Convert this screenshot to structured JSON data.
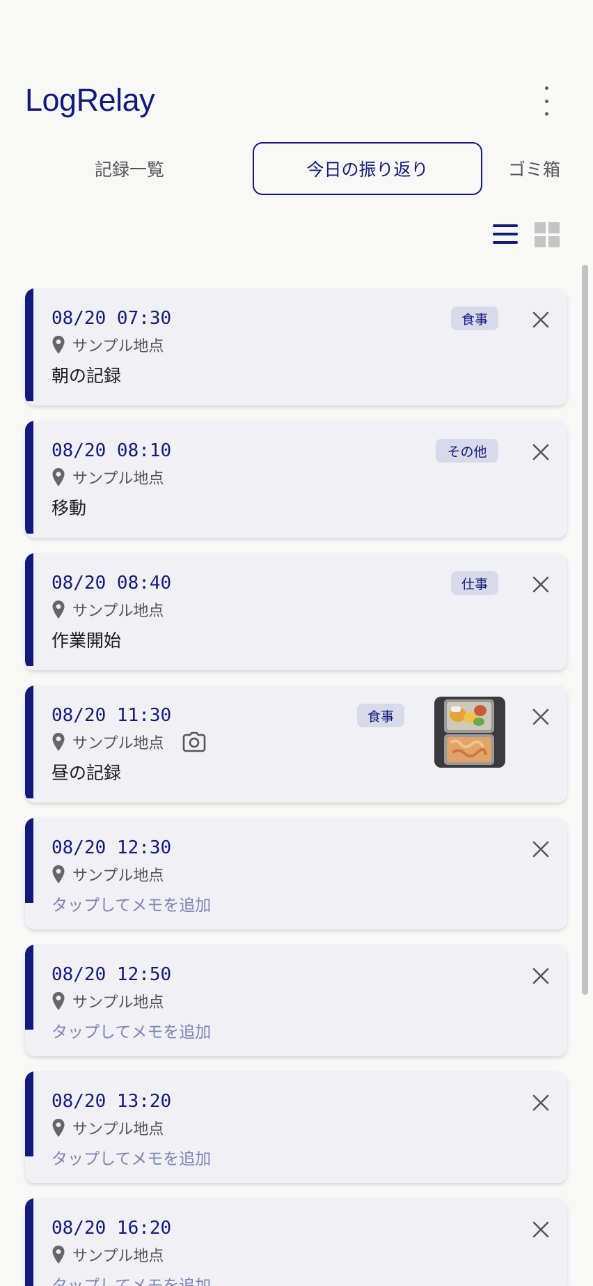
{
  "app": {
    "title": "LogRelay",
    "menu_icon": "more-vert-icon"
  },
  "tabs": [
    {
      "label": "記録一覧",
      "active": false
    },
    {
      "label": "今日の振り返り",
      "active": true
    },
    {
      "label": "ゴミ箱",
      "active": false
    }
  ],
  "view_toggle": {
    "list_icon": "list-view-icon",
    "grid_icon": "grid-view-icon",
    "selected": "list"
  },
  "colors": {
    "accent": "#121a7a",
    "card": "#f1f1f5",
    "badge_bg": "#d8d9ea",
    "placeholder": "#7d83b6"
  },
  "entries": [
    {
      "time": "08/20 07:30",
      "location": "サンプル地点",
      "tag": "食事",
      "memo": "朝の記録",
      "has_photo": false
    },
    {
      "time": "08/20 08:10",
      "location": "サンプル地点",
      "tag": "その他",
      "memo": "移動",
      "has_photo": false
    },
    {
      "time": "08/20 08:40",
      "location": "サンプル地点",
      "tag": "仕事",
      "memo": "作業開始",
      "has_photo": false
    },
    {
      "time": "08/20 11:30",
      "location": "サンプル地点",
      "tag": "食事",
      "memo": "昼の記録",
      "has_photo": true
    },
    {
      "time": "08/20 12:30",
      "location": "サンプル地点",
      "memo_placeholder": "タップしてメモを追加"
    },
    {
      "time": "08/20 12:50",
      "location": "サンプル地点",
      "memo_placeholder": "タップしてメモを追加"
    },
    {
      "time": "08/20 13:20",
      "location": "サンプル地点",
      "memo_placeholder": "タップしてメモを追加"
    },
    {
      "time": "08/20 16:20",
      "location": "サンプル地点",
      "memo_placeholder": "タップしてメモを追加"
    }
  ]
}
